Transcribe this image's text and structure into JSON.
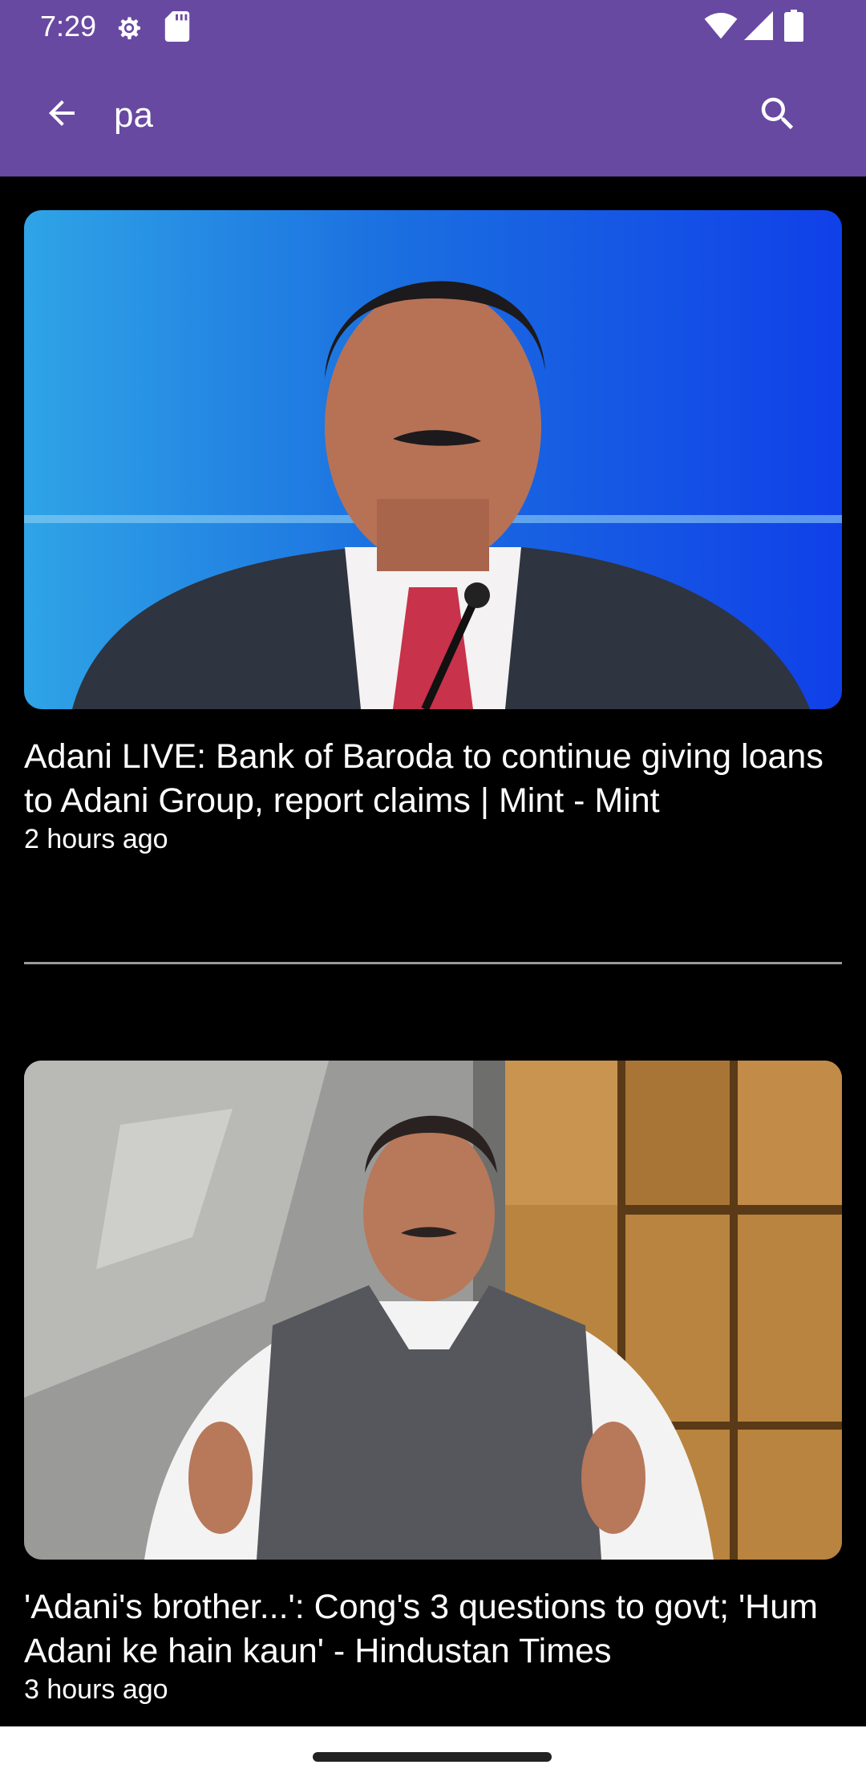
{
  "status": {
    "time": "7:29"
  },
  "search": {
    "query": "pa"
  },
  "articles": [
    {
      "headline": "Adani LIVE: Bank of Baroda to continue giving loans to Adani Group, report claims | Mint - Mint",
      "time": "2 hours ago"
    },
    {
      "headline": "'Adani's brother...': Cong's 3 questions to govt; 'Hum Adani ke hain kaun' - Hindustan Times",
      "time": "3 hours ago"
    }
  ],
  "colors": {
    "appbar": "#6849a1",
    "background": "#000000",
    "text": "#ffffff"
  },
  "icons": {
    "back": "arrow-back-icon",
    "search": "search-icon"
  }
}
